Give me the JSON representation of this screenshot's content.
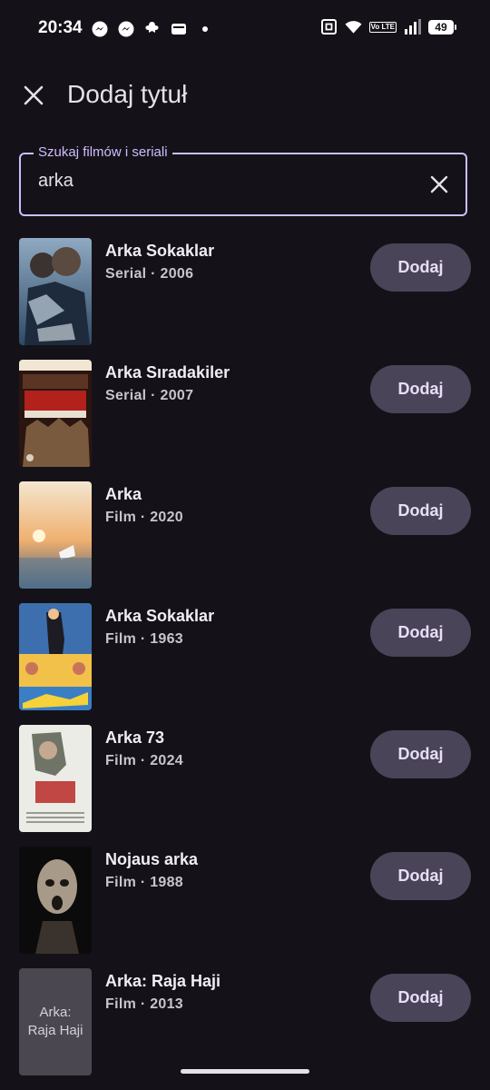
{
  "status_bar": {
    "time": "20:34",
    "battery": "49",
    "network_badge": "Vo LTE",
    "icons": [
      "messenger-icon",
      "messenger-icon",
      "app-notification-icon",
      "wallet-icon",
      "dot-icon",
      "nfc-icon",
      "wifi-icon",
      "volte-icon",
      "signal-icon",
      "battery-icon"
    ]
  },
  "header": {
    "title": "Dodaj tytuł",
    "close_icon": "close-icon"
  },
  "search": {
    "label": "Szukaj filmów i seriali",
    "value": "arka",
    "clear_icon": "clear-icon"
  },
  "results": [
    {
      "title": "Arka Sokaklar",
      "meta": "Serial · 2006",
      "action": "Dodaj"
    },
    {
      "title": "Arka Sıradakiler",
      "meta": "Serial · 2007",
      "action": "Dodaj"
    },
    {
      "title": "Arka",
      "meta": "Film · 2020",
      "action": "Dodaj"
    },
    {
      "title": "Arka Sokaklar",
      "meta": "Film · 1963",
      "action": "Dodaj"
    },
    {
      "title": "Arka 73",
      "meta": "Film · 2024",
      "action": "Dodaj"
    },
    {
      "title": "Nojaus arka",
      "meta": "Film · 1988",
      "action": "Dodaj"
    },
    {
      "title": "Arka: Raja Haji",
      "meta": "Film · 2013",
      "action": "Dodaj",
      "poster_placeholder": "Arka:\nRaja Haji"
    }
  ],
  "colors": {
    "background": "#141218",
    "accent": "#d0bcff",
    "button_bg": "#4a4458"
  }
}
